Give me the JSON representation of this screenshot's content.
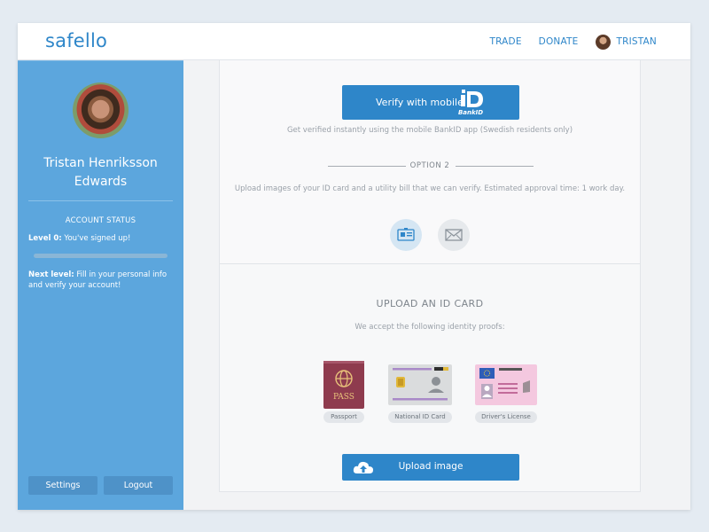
{
  "header": {
    "logo": "safello",
    "nav": {
      "trade": "TRADE",
      "donate": "DONATE",
      "user": "TRISTAN"
    }
  },
  "sidebar": {
    "name_line1": "Tristan Henriksson",
    "name_line2": "Edwards",
    "account_status_title": "ACCOUNT STATUS",
    "level_prefix": "Level 0:",
    "level_text": "You've signed up!",
    "progress": 0,
    "next_level_prefix": "Next level:",
    "next_level_text": "Fill in your personal info and verify your account!",
    "settings_label": "Settings",
    "logout_label": "Logout"
  },
  "verify": {
    "bankid_button_label": "Verify with mobile",
    "bankid_logo_text": "BankID",
    "caption": "Get verified instantly using the mobile BankID app (Swedish residents only)"
  },
  "option2": {
    "label": "OPTION 2",
    "description": "Upload images of your ID card and a utility bill that we can verify. Estimated approval time: 1 work day."
  },
  "upload": {
    "title": "UPLOAD AN ID CARD",
    "subtitle": "We accept the following identity proofs:",
    "documents": [
      {
        "label": "Passport",
        "icon_text": "PASS"
      },
      {
        "label": "National ID Card"
      },
      {
        "label": "Driver's License"
      }
    ],
    "button_label": "Upload image"
  },
  "colors": {
    "accent": "#2e86c9",
    "sidebar": "#5ca6dd",
    "passport": "#8e3b4e",
    "license": "#f4c8df"
  }
}
